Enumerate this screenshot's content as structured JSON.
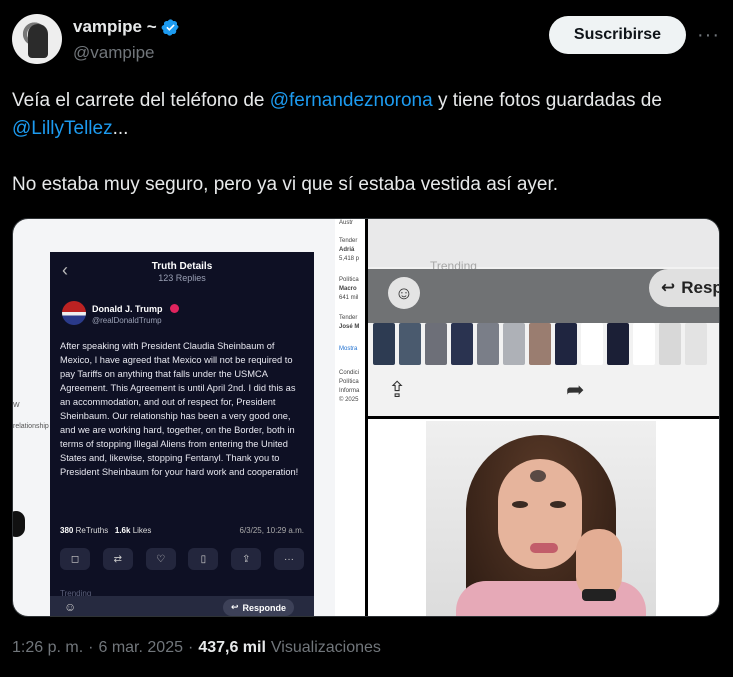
{
  "header": {
    "display_name": "vampipe ~",
    "handle": "@vampipe",
    "subscribe_label": "Suscribirse",
    "more_label": "···"
  },
  "tweet": {
    "line1_before": "Veía el carrete del teléfono de ",
    "mention1": "@fernandeznorona",
    "line1_after": " y tiene fotos guardadas de ",
    "mention2": "@LillyTellez",
    "line1_end": "...",
    "line2": "No estaba muy seguro, pero ya vi que sí estaba vestida así ayer."
  },
  "media": {
    "truth": {
      "header_title": "Truth Details",
      "header_sub": "123 Replies",
      "author_name": "Donald J. Trump",
      "author_handle": "@realDonaldTrump",
      "body": "After speaking with President Claudia Sheinbaum of Mexico, I have agreed that Mexico will not be required to pay Tariffs on anything that falls under the USMCA Agreement. This Agreement is until April 2nd. I did this as an accommodation, and out of respect for, President Sheinbaum. Our relationship has been a very good one, and we are working hard, together, on the Border, both in terms of stopping Illegal Aliens from entering the United States and, likewise, stopping Fentanyl. Thank you to President Sheinbaum for your hard work and cooperation!",
      "retruths_count": "380",
      "retruths_label": "ReTruths",
      "likes_count": "1.6k",
      "likes_label": "Likes",
      "date": "6/3/25, 10:29 a.m.",
      "trending": "Trending",
      "respond_label": "Responde"
    },
    "side_texts": [
      "Austr",
      "Tender",
      "Adriá",
      "5,418 p",
      "Política",
      "Macro",
      "641 mil",
      "Tender",
      "José M",
      "Mostra",
      "Condici",
      "Política",
      "Informa",
      "© 2025"
    ],
    "camera_roll": {
      "trending": "Trending",
      "respond_label": "Resp"
    }
  },
  "footer": {
    "time": "1:26 p. m.",
    "sep1": "·",
    "date": "6 mar. 2025",
    "sep2": "·",
    "views_count": "437,6 mil",
    "views_label": "Visualizaciones"
  },
  "colors": {
    "accent": "#1d9bf0",
    "background": "#000000",
    "muted": "#71767b"
  }
}
